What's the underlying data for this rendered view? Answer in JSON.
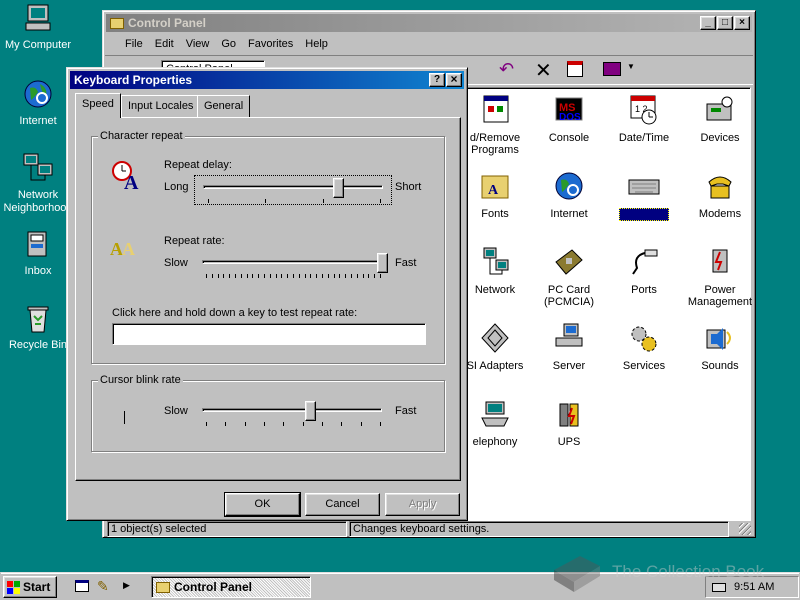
{
  "desktop": {
    "icons": [
      {
        "label": "My Computer"
      },
      {
        "label": "Internet"
      },
      {
        "label": "Network Neighborhood"
      },
      {
        "label": "Inbox"
      },
      {
        "label": "Recycle Bin"
      }
    ]
  },
  "control_panel": {
    "title": "Control Panel",
    "menu": [
      "File",
      "Edit",
      "View",
      "Go",
      "Favorites",
      "Help"
    ],
    "address_value": "Control Panel",
    "items": [
      {
        "label": "d/Remove Programs"
      },
      {
        "label": "Console"
      },
      {
        "label": "Date/Time"
      },
      {
        "label": "Devices"
      },
      {
        "label": "Fonts"
      },
      {
        "label": "Internet"
      },
      {
        "label": ""
      },
      {
        "label": "Modems"
      },
      {
        "label": "Network"
      },
      {
        "label": "PC Card (PCMCIA)"
      },
      {
        "label": "Ports"
      },
      {
        "label": "Power Management"
      },
      {
        "label": "SI Adapters"
      },
      {
        "label": "Server"
      },
      {
        "label": "Services"
      },
      {
        "label": "Sounds"
      },
      {
        "label": "elephony"
      },
      {
        "label": "UPS"
      }
    ],
    "status_left": "1 object(s) selected",
    "status_right": "Changes keyboard settings."
  },
  "dialog": {
    "title": "Keyboard Properties",
    "help_btn": "?",
    "close_btn": "×",
    "tabs": [
      "Speed",
      "Input Locales",
      "General"
    ],
    "char_repeat": {
      "group_label": "Character repeat",
      "delay_label": "Repeat delay:",
      "delay_min": "Long",
      "delay_max": "Short",
      "delay_value": 0.75,
      "rate_label": "Repeat rate:",
      "rate_min": "Slow",
      "rate_max": "Fast",
      "rate_value": 1.0,
      "test_label": "Click here and hold down a key to test repeat rate:",
      "test_value": ""
    },
    "cursor_blink": {
      "group_label": "Cursor blink rate",
      "min": "Slow",
      "max": "Fast",
      "value": 0.6
    },
    "buttons": {
      "ok": "OK",
      "cancel": "Cancel",
      "apply": "Apply"
    }
  },
  "taskbar": {
    "start": "Start",
    "task": "Control Panel",
    "clock": "9:51 AM"
  },
  "watermark": "The Collection Book"
}
